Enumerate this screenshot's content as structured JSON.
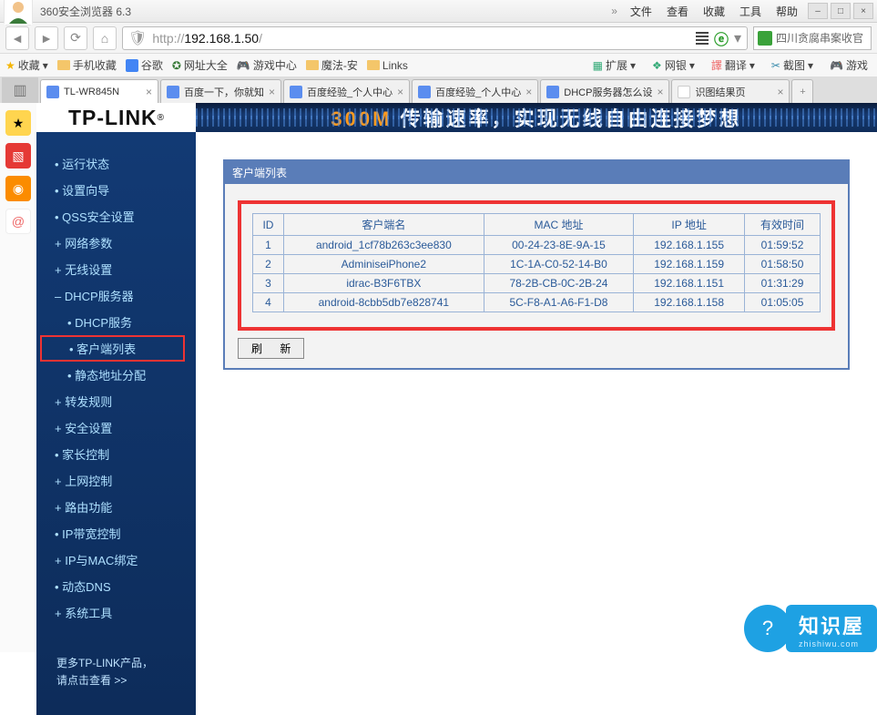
{
  "browser": {
    "title": "360安全浏览器 6.3",
    "menus": [
      "文件",
      "查看",
      "收藏",
      "工具",
      "帮助"
    ],
    "url_prefix": "http://",
    "url_host": "192.168.1.50",
    "url_suffix": "/",
    "search_placeholder": "四川贪腐串案收官"
  },
  "bookmarks": {
    "fav_label": "收藏",
    "items": [
      "手机收藏",
      "谷歌",
      "网址大全",
      "游戏中心",
      "魔法-安",
      "Links"
    ],
    "right": [
      "扩展",
      "网银",
      "翻译",
      "截图",
      "游戏"
    ]
  },
  "tabs": {
    "items": [
      {
        "label": "TL-WR845N",
        "active": true
      },
      {
        "label": "百度一下，你就知"
      },
      {
        "label": "百度经验_个人中心"
      },
      {
        "label": "百度经验_个人中心"
      },
      {
        "label": "DHCP服务器怎么设"
      },
      {
        "label": "识图结果页"
      }
    ]
  },
  "banner": {
    "logo": "TP-LINK",
    "text_orange": "300M",
    "text_white": "传输速率，实现无线自由连接梦想"
  },
  "nav": {
    "items": [
      {
        "label": "运行状态",
        "type": "dot"
      },
      {
        "label": "设置向导",
        "type": "dot"
      },
      {
        "label": "QSS安全设置",
        "type": "dot"
      },
      {
        "label": "网络参数",
        "type": "plus"
      },
      {
        "label": "无线设置",
        "type": "plus"
      },
      {
        "label": "DHCP服务器",
        "type": "minus"
      },
      {
        "label": "DHCP服务",
        "type": "dot",
        "sub": true
      },
      {
        "label": "客户端列表",
        "type": "dot",
        "sub": true,
        "boxed": true
      },
      {
        "label": "静态地址分配",
        "type": "dot",
        "sub": true
      },
      {
        "label": "转发规则",
        "type": "plus"
      },
      {
        "label": "安全设置",
        "type": "plus"
      },
      {
        "label": "家长控制",
        "type": "dot"
      },
      {
        "label": "上网控制",
        "type": "plus"
      },
      {
        "label": "路由功能",
        "type": "plus"
      },
      {
        "label": "IP带宽控制",
        "type": "dot"
      },
      {
        "label": "IP与MAC绑定",
        "type": "plus"
      },
      {
        "label": "动态DNS",
        "type": "dot"
      },
      {
        "label": "系统工具",
        "type": "plus"
      }
    ],
    "more1": "更多TP-LINK产品，",
    "more2": "请点击查看 >>"
  },
  "panel": {
    "title": "客户端列表",
    "headers": [
      "ID",
      "客户端名",
      "MAC 地址",
      "IP 地址",
      "有效时间"
    ],
    "rows": [
      {
        "id": "1",
        "name": "android_1cf78b263c3ee830",
        "mac": "00-24-23-8E-9A-15",
        "ip": "192.168.1.155",
        "time": "01:59:52"
      },
      {
        "id": "2",
        "name": "AdminiseiPhone2",
        "mac": "1C-1A-C0-52-14-B0",
        "ip": "192.168.1.159",
        "time": "01:58:50"
      },
      {
        "id": "3",
        "name": "idrac-B3F6TBX",
        "mac": "78-2B-CB-0C-2B-24",
        "ip": "192.168.1.151",
        "time": "01:31:29"
      },
      {
        "id": "4",
        "name": "android-8cbb5db7e828741",
        "mac": "5C-F8-A1-A6-F1-D8",
        "ip": "192.168.1.158",
        "time": "01:05:05"
      }
    ],
    "refresh": "刷 新"
  },
  "watermark": {
    "name": "知识屋",
    "domain": "zhishiwu.com"
  }
}
